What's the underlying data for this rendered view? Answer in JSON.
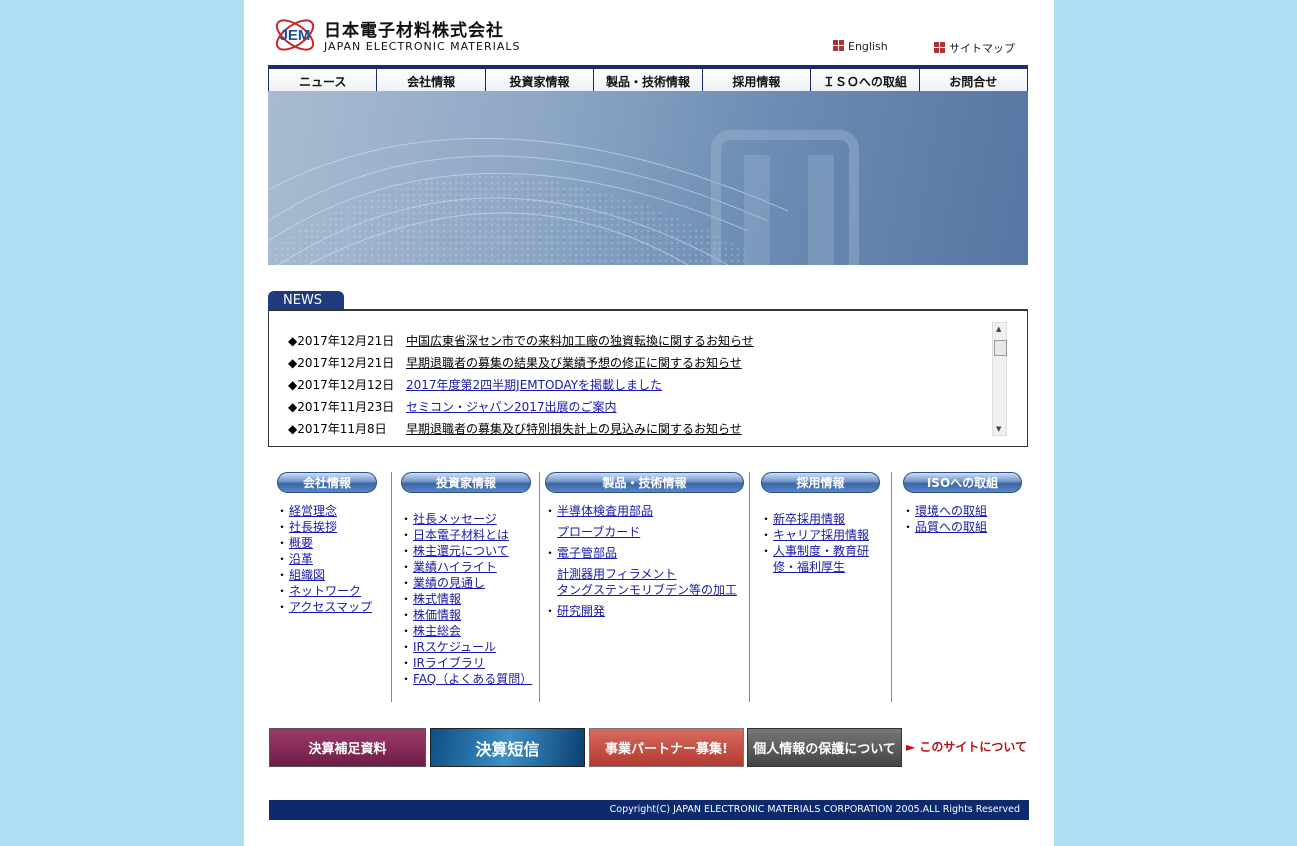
{
  "header": {
    "logo_mark": "JEM",
    "company_jp": "日本電子材料株式会社",
    "company_en": "JAPAN ELECTRONIC MATERIALS",
    "english_link": "English",
    "sitemap_link": "サイトマップ",
    "accent_color": "#1a2d6b"
  },
  "nav": {
    "items": [
      "ニュース",
      "会社情報",
      "投資家情報",
      "製品・技術情報",
      "採用情報",
      "ＩＳＯへの取組",
      "お問合せ"
    ]
  },
  "news": {
    "title": "NEWS",
    "items": [
      {
        "date": "◆2017年12月21日",
        "text": "中国広東省深セン市での来料加工廠の独資転換に関するお知らせ"
      },
      {
        "date": "◆2017年12月21日",
        "text": "早期退職者の募集の結果及び業績予想の修正に関するお知らせ"
      },
      {
        "date": "◆2017年12月12日",
        "text": "2017年度第2四半期JEMTODAYを掲載しました"
      },
      {
        "date": "◆2017年11月23日",
        "text": "セミコン・ジャパン2017出展のご案内"
      },
      {
        "date": "◆2017年11月8日",
        "text": "早期退職者の募集及び特別損失計上の見込みに関するお知らせ"
      }
    ]
  },
  "categories": {
    "company": {
      "title": "会社情報",
      "links": [
        "経営理念",
        "社長挨拶",
        "概要",
        "沿革",
        "組織図",
        "ネットワーク",
        "アクセスマップ"
      ]
    },
    "investor": {
      "title": "投資家情報",
      "links": [
        "社長メッセージ",
        "日本電子材料とは",
        "株主還元について",
        "業績ハイライト",
        "業績の見通し",
        "株式情報",
        "株価情報",
        "株主総会",
        "IRスケジュール",
        "IRライブラリ",
        "FAQ（よくある質問）"
      ]
    },
    "products": {
      "title": "製品・技術情報",
      "links": [
        "半導体検査用部品",
        "プローブカード",
        "電子管部品",
        "計測器用フィラメント",
        "タングステンモリブデン等の加工",
        "研究開発"
      ]
    },
    "recruit": {
      "title": "採用情報",
      "links": [
        "新卒採用情報",
        "キャリア採用情報",
        "人事制度・教育研修・福利厚生"
      ]
    },
    "iso": {
      "title": "ISOへの取組",
      "links": [
        "環境への取組",
        "品質への取組"
      ]
    }
  },
  "banners": {
    "b1": "決算補足資料",
    "b2": "決算短信",
    "b3": "事業パートナー募集!",
    "b4": "個人情報の保護について",
    "about": "► このサイトについて"
  },
  "footer": {
    "copyright": "Copyright(C) JAPAN ELECTRONIC MATERIALS CORPORATION 2005.ALL Rights Reserved"
  }
}
